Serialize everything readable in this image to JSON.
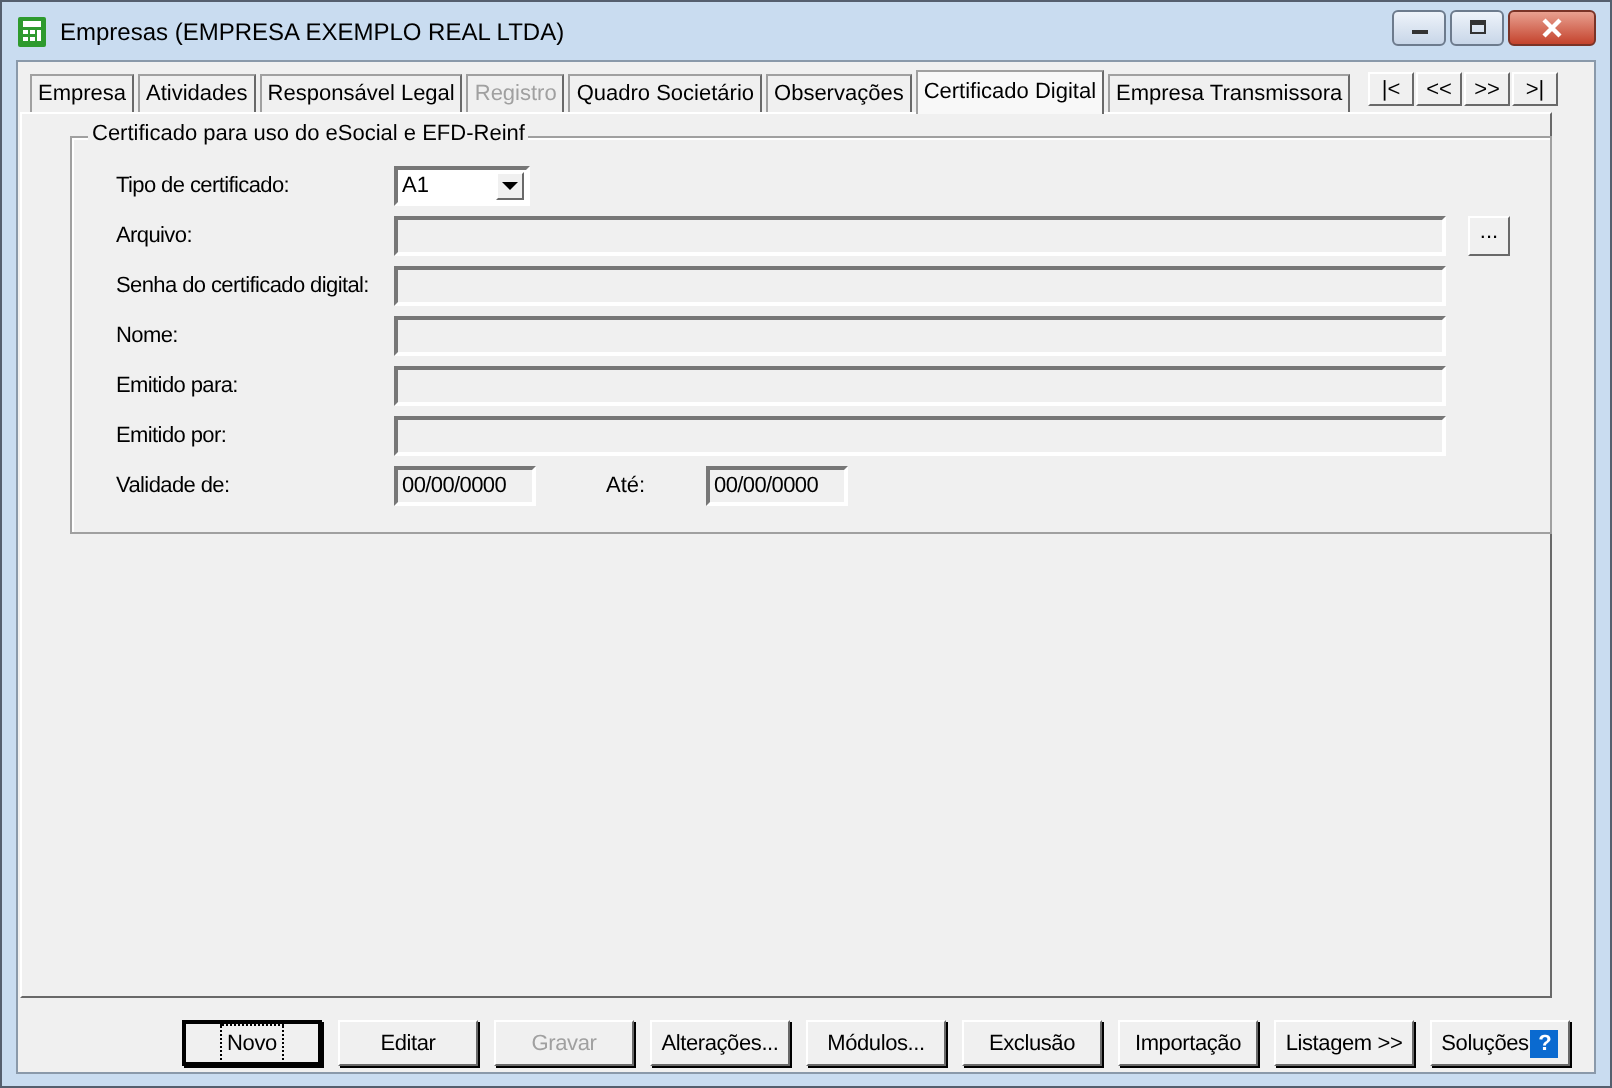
{
  "window": {
    "title": "Empresas (EMPRESA EXEMPLO REAL LTDA)"
  },
  "tabs": [
    {
      "label": "Empresa",
      "selected": false,
      "disabled": false
    },
    {
      "label": "Atividades",
      "selected": false,
      "disabled": false
    },
    {
      "label": "Responsável Legal",
      "selected": false,
      "disabled": false
    },
    {
      "label": "Registro",
      "selected": false,
      "disabled": true
    },
    {
      "label": "Quadro Societário",
      "selected": false,
      "disabled": false
    },
    {
      "label": "Observações",
      "selected": false,
      "disabled": false
    },
    {
      "label": "Certificado Digital",
      "selected": true,
      "disabled": false
    },
    {
      "label": "Empresa Transmissora",
      "selected": false,
      "disabled": false
    }
  ],
  "record_nav": [
    "|<",
    "<<",
    ">>",
    ">|"
  ],
  "group": {
    "title": "Certificado para uso do eSocial e EFD-Reinf",
    "fields": [
      {
        "kind": "dropdown",
        "label": "Tipo de certificado:",
        "value": "A1"
      },
      {
        "kind": "file",
        "label": "Arquivo:",
        "button": "..."
      },
      {
        "kind": "text",
        "label": "Senha do certificado digital:"
      },
      {
        "kind": "text",
        "label": "Nome:"
      },
      {
        "kind": "text",
        "label": "Emitido para:"
      },
      {
        "kind": "text",
        "label": "Emitido por:"
      },
      {
        "kind": "range",
        "label": "Validade de:",
        "value": "00/00/0000",
        "label_to": "Até:",
        "value_to": "00/00/0000"
      }
    ]
  },
  "buttons": [
    {
      "label": "Novo",
      "disabled": false,
      "focused": true
    },
    {
      "label": "Editar",
      "disabled": false,
      "focused": false
    },
    {
      "label": "Gravar",
      "disabled": true,
      "focused": false
    },
    {
      "label": "Alterações...",
      "disabled": false,
      "focused": false
    },
    {
      "label": "Módulos...",
      "disabled": false,
      "focused": false
    },
    {
      "label": "Exclusão",
      "disabled": false,
      "focused": false
    },
    {
      "label": "Importação",
      "disabled": false,
      "focused": false
    },
    {
      "label": "Listagem >>",
      "disabled": false,
      "focused": false
    },
    {
      "label": "Soluções",
      "disabled": false,
      "focused": false,
      "help_icon": "?"
    }
  ]
}
